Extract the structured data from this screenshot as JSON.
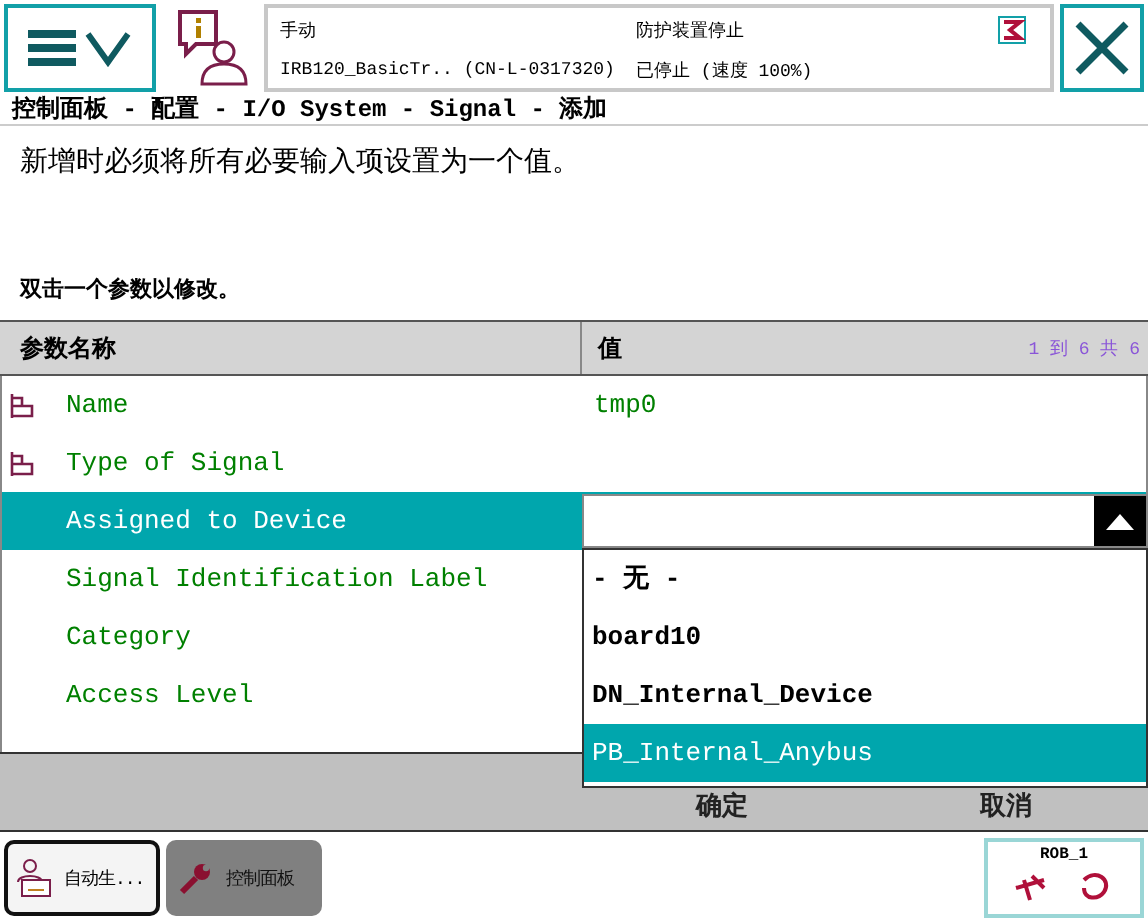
{
  "header": {
    "mode": "手动",
    "controller": "IRB120_BasicTr.. (CN-L-0317320)",
    "safety": "防护装置停止",
    "state": "已停止 (速度 100%)"
  },
  "breadcrumb": "控制面板 - 配置 - I/O System - Signal - 添加",
  "instruction": "新增时必须将所有必要输入项设置为一个值。",
  "hint": "双击一个参数以修改。",
  "table": {
    "columns": [
      "参数名称",
      "值"
    ],
    "range": "1 到 6 共 6",
    "rows": [
      {
        "name": "Name",
        "value": "tmp0",
        "required": true,
        "selected": false
      },
      {
        "name": "Type of Signal",
        "required": true,
        "selected": false
      },
      {
        "name": "Assigned to Device",
        "required": false,
        "selected": true
      },
      {
        "name": "Signal Identification Label",
        "required": false,
        "selected": false
      },
      {
        "name": "Category",
        "required": false,
        "selected": false
      },
      {
        "name": "Access Level",
        "required": false,
        "selected": false
      }
    ]
  },
  "dropdown": {
    "options": [
      {
        "label": "- 无 -",
        "selected": false
      },
      {
        "label": "board10",
        "selected": false
      },
      {
        "label": "DN_Internal_Device",
        "selected": false
      },
      {
        "label": "PB_Internal_Anybus",
        "selected": true
      }
    ]
  },
  "buttons": [
    "确定",
    "取消"
  ],
  "taskbar": [
    {
      "kind": "program",
      "label": "自动生...",
      "selected": true
    },
    {
      "kind": "settings",
      "label": "控制面板",
      "selected": false
    }
  ],
  "robot": "ROB_1"
}
